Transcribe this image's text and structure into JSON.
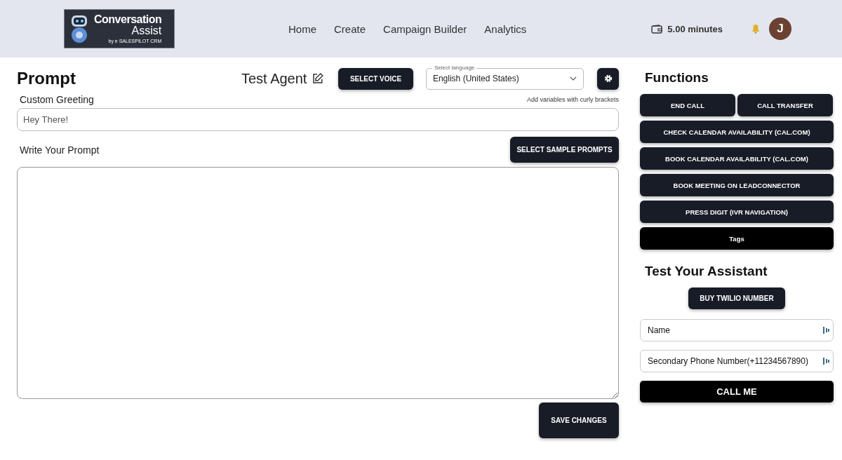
{
  "header": {
    "logo": {
      "title_line_1": "Conversation",
      "title_line_2": "Assist",
      "byline": "by e SALESPILOT CRM"
    },
    "nav": [
      {
        "label": "Home"
      },
      {
        "label": "Create"
      },
      {
        "label": "Campaign Builder"
      },
      {
        "label": "Analytics"
      }
    ],
    "balance": "5.00 minutes",
    "avatar_initial": "J"
  },
  "prompt": {
    "title": "Prompt",
    "agent_name": "Test Agent",
    "voice_button": "SELECT VOICE",
    "language": {
      "label": "Select language",
      "value": "English (United States)"
    },
    "greeting_label": "Custom Greeting",
    "greeting_hint": "Add variables with curly brackets",
    "greeting_value": "Hey There!",
    "prompt_label": "Write Your Prompt",
    "sample_button": "SELECT SAMPLE PROMPTS",
    "save_button": "SAVE CHANGES"
  },
  "functions": {
    "title": "Functions",
    "buttons": [
      {
        "label": "END CALL",
        "kind": "half"
      },
      {
        "label": "CALL TRANSFER",
        "kind": "half"
      },
      {
        "label": "CHECK CALENDAR AVAILABILITY (CAL.COM)",
        "kind": "full"
      },
      {
        "label": "BOOK CALENDAR AVAILABILITY (CAL.COM)",
        "kind": "full"
      },
      {
        "label": "BOOK MEETING ON LEADCONNECTOR",
        "kind": "full"
      },
      {
        "label": "PRESS DIGIT (IVR NAVIGATION)",
        "kind": "full"
      },
      {
        "label": "Tags",
        "kind": "tag"
      }
    ]
  },
  "test": {
    "title": "Test Your Assistant",
    "buy_button": "BUY TWILIO NUMBER",
    "fields": [
      {
        "placeholder": "Name"
      },
      {
        "placeholder": "Secondary Phone Number(+11234567890)"
      }
    ],
    "call_button": "CALL ME"
  }
}
